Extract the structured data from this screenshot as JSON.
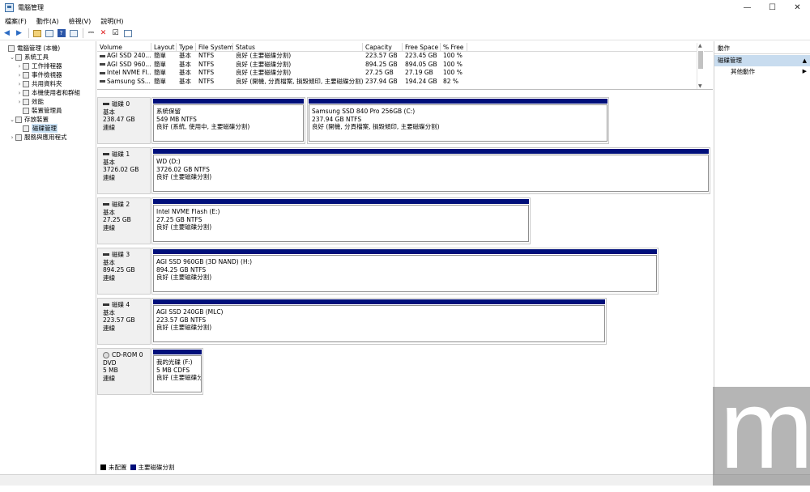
{
  "window": {
    "title": "電腦管理"
  },
  "menu": [
    "檔案(F)",
    "動作(A)",
    "檢視(V)",
    "說明(H)"
  ],
  "tree": [
    {
      "label": "電腦管理 (本機)",
      "caret": "",
      "depth": 0
    },
    {
      "label": "系統工具",
      "caret": "v",
      "depth": 1
    },
    {
      "label": "工作排程器",
      "caret": ">",
      "depth": 2
    },
    {
      "label": "事件檢視器",
      "caret": ">",
      "depth": 2
    },
    {
      "label": "共用資料夾",
      "caret": ">",
      "depth": 2
    },
    {
      "label": "本機使用者和群組",
      "caret": ">",
      "depth": 2
    },
    {
      "label": "效能",
      "caret": ">",
      "depth": 2
    },
    {
      "label": "裝置管理員",
      "caret": "",
      "depth": 2
    },
    {
      "label": "存放裝置",
      "caret": "v",
      "depth": 1
    },
    {
      "label": "磁碟管理",
      "caret": "",
      "depth": 2,
      "selected": true
    },
    {
      "label": "服務與應用程式",
      "caret": ">",
      "depth": 1
    }
  ],
  "volume_table": {
    "headers": [
      "Volume",
      "Layout",
      "Type",
      "File System",
      "Status",
      "Capacity",
      "Free Space",
      "% Free"
    ],
    "rows": [
      [
        "AGI SSD 240...",
        "簡單",
        "基本",
        "NTFS",
        "良好 (主要磁碟分割)",
        "223.57 GB",
        "223.45 GB",
        "100 %"
      ],
      [
        "AGI SSD 960...",
        "簡單",
        "基本",
        "NTFS",
        "良好 (主要磁碟分割)",
        "894.25 GB",
        "894.05 GB",
        "100 %"
      ],
      [
        "Intel NVME Fl...",
        "簡單",
        "基本",
        "NTFS",
        "良好 (主要磁碟分割)",
        "27.25 GB",
        "27.19 GB",
        "100 %"
      ],
      [
        "Samsung SS...",
        "簡單",
        "基本",
        "NTFS",
        "良好 (開機, 分頁檔案, 損毀傾印, 主要磁碟分割)",
        "237.94 GB",
        "194.24 GB",
        "82 %"
      ]
    ]
  },
  "disks": [
    {
      "name": "磁碟 0",
      "kind": "基本",
      "size": "238.47 GB",
      "state": "連線",
      "partitions": [
        {
          "name": "系統保留",
          "size": "549 MB NTFS",
          "status": "良好 (系統, 使用中, 主要磁碟分割)"
        },
        {
          "name": "Samsung SSD 840 Pro 256GB  (C:)",
          "size": "237.94 GB NTFS",
          "status": "良好 (開機, 分頁檔案, 損毀傾印, 主要磁碟分割)"
        }
      ]
    },
    {
      "name": "磁碟 1",
      "kind": "基本",
      "size": "3726.02 GB",
      "state": "連線",
      "partitions": [
        {
          "name": "WD  (D:)",
          "size": "3726.02 GB NTFS",
          "status": "良好 (主要磁碟分割)"
        }
      ]
    },
    {
      "name": "磁碟 2",
      "kind": "基本",
      "size": "27.25 GB",
      "state": "連線",
      "partitions": [
        {
          "name": "Intel NVME Flash  (E:)",
          "size": "27.25 GB NTFS",
          "status": "良好 (主要磁碟分割)"
        }
      ]
    },
    {
      "name": "磁碟 3",
      "kind": "基本",
      "size": "894.25 GB",
      "state": "連線",
      "partitions": [
        {
          "name": "AGI SSD 960GB (3D NAND)  (H:)",
          "size": "894.25 GB NTFS",
          "status": "良好 (主要磁碟分割)"
        }
      ]
    },
    {
      "name": "磁碟 4",
      "kind": "基本",
      "size": "223.57 GB",
      "state": "連線",
      "partitions": [
        {
          "name": "AGI SSD 240GB (MLC)",
          "size": "223.57 GB NTFS",
          "status": "良好 (主要磁碟分割)"
        }
      ]
    },
    {
      "name": "CD-ROM 0",
      "kind": "DVD",
      "size": "5 MB",
      "state": "連線",
      "partitions": [
        {
          "name": "我的光碟  (F:)",
          "size": "5 MB CDFS",
          "status": "良好 (主要磁碟分割)"
        }
      ]
    }
  ],
  "legend": [
    {
      "label": "未配置",
      "color": "#000000"
    },
    {
      "label": "主要磁碟分割",
      "color": "#000f7a"
    }
  ],
  "actions": {
    "title": "動作",
    "section": "磁碟管理",
    "items": [
      "其他動作"
    ]
  },
  "watermark": "m"
}
